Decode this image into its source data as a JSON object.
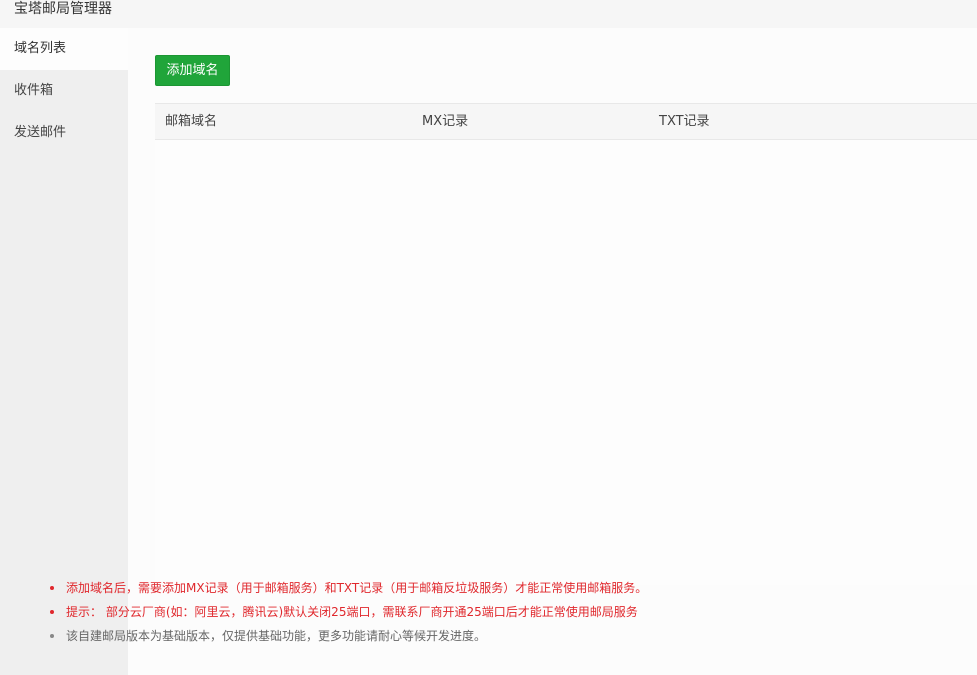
{
  "window": {
    "title": "宝塔邮局管理器"
  },
  "sidebar": {
    "items": [
      {
        "label": "域名列表",
        "active": true
      },
      {
        "label": "收件箱",
        "active": false
      },
      {
        "label": "发送邮件",
        "active": false
      }
    ]
  },
  "toolbar": {
    "add_domain_label": "添加域名"
  },
  "table": {
    "columns": [
      "邮箱域名",
      "MX记录",
      "TXT记录"
    ],
    "rows": []
  },
  "tips": [
    {
      "text": "添加域名后，需要添加MX记录（用于邮箱服务）和TXT记录（用于邮箱反垃圾服务）才能正常使用邮箱服务。",
      "color": "#e0282d"
    },
    {
      "text": "提示：  部分云厂商(如：阿里云，腾讯云)默认关闭25端口，需联系厂商开通25端口后才能正常使用邮局服务",
      "color": "#e0282d"
    },
    {
      "text": "该自建邮局版本为基础版本，仅提供基础功能，更多功能请耐心等候开发进度。",
      "color": "#666666"
    }
  ],
  "colors": {
    "accent": "#20a53a",
    "warning": "#e0282d"
  }
}
